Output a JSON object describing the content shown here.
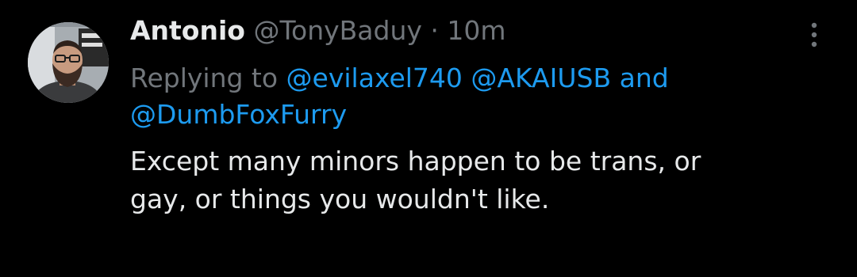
{
  "tweet": {
    "display_name": "Antonio",
    "handle": "@TonyBaduy",
    "separator": "·",
    "timestamp": "10m",
    "replying_prefix": "Replying to",
    "mentions": [
      "@evilaxel740",
      "@AKAIUSB",
      "@DumbFoxFurry"
    ],
    "mention_joiner": "and",
    "text_line1": "Except many minors happen to be trans, or",
    "text_line2": "gay, or things you wouldn't like.",
    "more_icon": "more-vertical-icon",
    "colors": {
      "background": "#000000",
      "primary_text": "#e7e9ea",
      "secondary_text": "#71767b",
      "accent": "#1d9bf0"
    }
  }
}
